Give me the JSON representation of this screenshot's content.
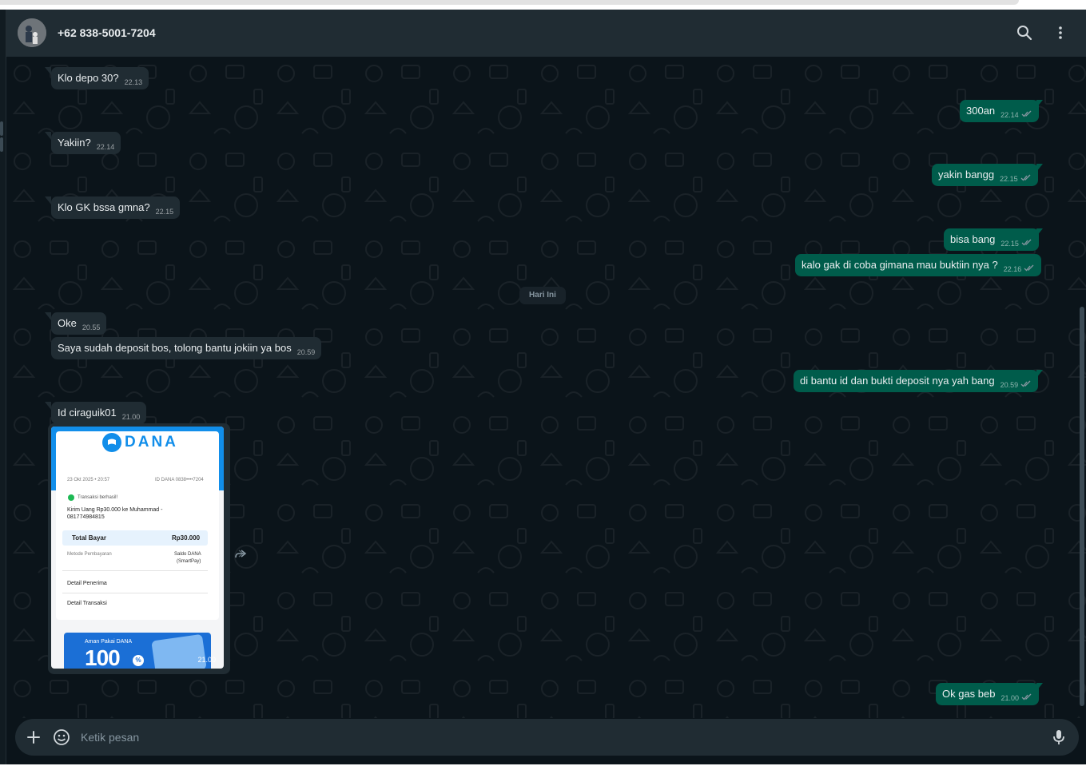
{
  "header": {
    "contact_name": "+62 838-5001-7204",
    "icons": [
      "search-icon",
      "menu-dots-icon"
    ]
  },
  "day_separator": "Hari Ini",
  "messages": [
    {
      "dir": "in",
      "text": "Klo depo 30?",
      "time": "22.13"
    },
    {
      "dir": "out",
      "text": "300an",
      "time": "22.14",
      "status": "read"
    },
    {
      "dir": "in",
      "text": "Yakiin?",
      "time": "22.14"
    },
    {
      "dir": "out",
      "text": "yakin bangg",
      "time": "22.15",
      "status": "read"
    },
    {
      "dir": "in",
      "text": "Klo GK bssa gmna?",
      "time": "22.15"
    },
    {
      "dir": "out",
      "text": "bisa bang",
      "time": "22.15",
      "status": "read"
    },
    {
      "dir": "out",
      "text": "kalo gak di coba gimana mau buktiin nya ?",
      "time": "22.16",
      "status": "read"
    },
    {
      "dir": "in",
      "text": "Oke",
      "time": "20.55"
    },
    {
      "dir": "in",
      "text": "Saya sudah deposit bos, tolong bantu jokiin ya bos",
      "time": "20.59"
    },
    {
      "dir": "out",
      "text": "di bantu id dan bukti deposit nya yah bang",
      "time": "20.59",
      "status": "read"
    },
    {
      "dir": "in",
      "text": "Id ciraguik01",
      "time": "21.00"
    },
    {
      "dir": "out",
      "text": "Ok gas beb",
      "time": "21.00",
      "status": "read"
    }
  ],
  "image_message": {
    "time": "21.00",
    "receipt": {
      "brand": "DANA",
      "date": "23 Okt 2025 • 20:57",
      "id_label": "ID DANA 0838••••7204",
      "status": "Transaksi berhasil!",
      "description": "Kirim Uang Rp30.000 ke Muhammad - 081774984815",
      "total_label": "Total Bayar",
      "total_value": "Rp30.000",
      "method_label": "Metode Pembayaran",
      "method_value_1": "Saldo DANA",
      "method_value_2": "(SmartPay)",
      "detail_recipient": "Detail Penerima",
      "detail_transaction": "Detail Transaksi",
      "promo_small": "Aman Pakai DANA",
      "promo_big": "100",
      "promo_pct": "%"
    }
  },
  "composer": {
    "placeholder": "Ketik pesan",
    "icons": [
      "plus-icon",
      "sticker-icon",
      "microphone-icon"
    ]
  },
  "colors": {
    "background": "#0b141a",
    "header": "#202c33",
    "incoming_bubble": "#202c33",
    "outgoing_bubble": "#005c4b",
    "read_ticks": "#8696a0",
    "text": "#e9edef"
  }
}
